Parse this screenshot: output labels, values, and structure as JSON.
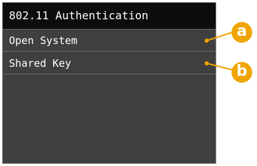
{
  "screen": {
    "title": "802.11 Authentication",
    "items": [
      {
        "label": "Open System"
      },
      {
        "label": "Shared Key"
      }
    ]
  },
  "callouts": [
    {
      "letter": "a"
    },
    {
      "letter": "b"
    }
  ],
  "colors": {
    "screen_background": "#3f3f3f",
    "title_background": "#0d0d0d",
    "text": "#ffffff",
    "callout": "#f0a400"
  }
}
